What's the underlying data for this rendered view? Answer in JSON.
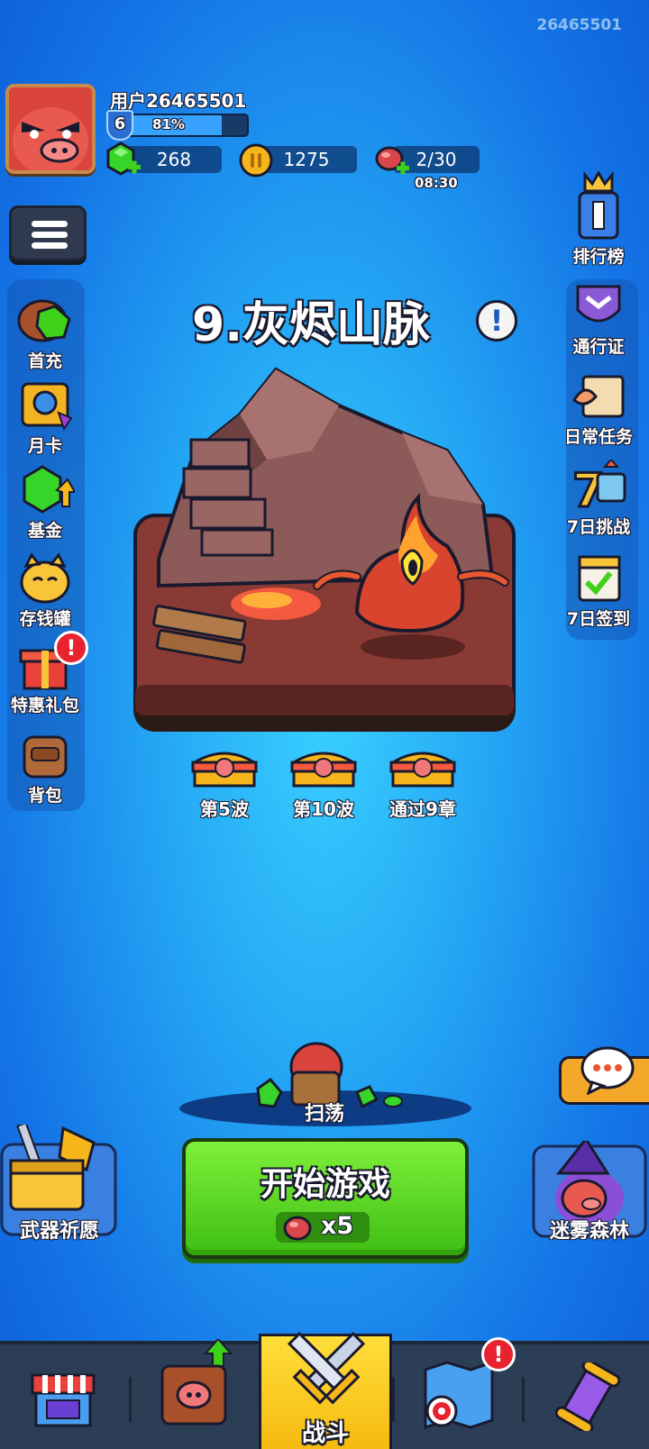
{
  "corner_id": "26465501",
  "player": {
    "username": "用户26465501",
    "level": "6",
    "exp_percent_label": "81%",
    "exp_fraction": 0.81
  },
  "resources": {
    "gems": "268",
    "coins": "1275",
    "stamina": "2/30",
    "stamina_timer": "08:30"
  },
  "left_menu": [
    {
      "label": "首充",
      "icon": "first-recharge-icon"
    },
    {
      "label": "月卡",
      "icon": "monthly-card-icon"
    },
    {
      "label": "基金",
      "icon": "fund-icon"
    },
    {
      "label": "存钱罐",
      "icon": "piggy-bank-icon"
    },
    {
      "label": "特惠礼包",
      "icon": "gift-pack-icon",
      "badge": "!"
    },
    {
      "label": "背包",
      "icon": "backpack-icon"
    }
  ],
  "right_menu": [
    {
      "label": "排行榜",
      "icon": "leaderboard-icon"
    },
    {
      "label": "通行证",
      "icon": "pass-icon"
    },
    {
      "label": "日常任务",
      "icon": "daily-task-icon"
    },
    {
      "label": "7日挑战",
      "icon": "seven-day-challenge-icon"
    },
    {
      "label": "7日签到",
      "icon": "seven-day-signin-icon"
    }
  ],
  "stage": {
    "title": "9.灰烬山脉",
    "info": "!"
  },
  "rewards": [
    {
      "label": "第5波"
    },
    {
      "label": "第10波"
    },
    {
      "label": "通过9章"
    }
  ],
  "sweep_label": "扫荡",
  "start_button": {
    "label": "开始游戏",
    "cost": "x5"
  },
  "weapon_wish": "武器祈愿",
  "mist_forest": "迷雾森林",
  "chat": "...",
  "bottom_nav": [
    {
      "label": "",
      "icon": "shop-icon"
    },
    {
      "label": "",
      "icon": "equipment-icon"
    },
    {
      "label": "战斗",
      "icon": "battle-swords-icon",
      "active": true
    },
    {
      "label": "",
      "icon": "map-target-icon",
      "badge": "!"
    },
    {
      "label": "",
      "icon": "scroll-icon"
    }
  ],
  "colors": {
    "background": "#25a8f5",
    "start_button": "#4fd11a",
    "active_tab": "#f5c21a",
    "badge": "#e8232f"
  }
}
